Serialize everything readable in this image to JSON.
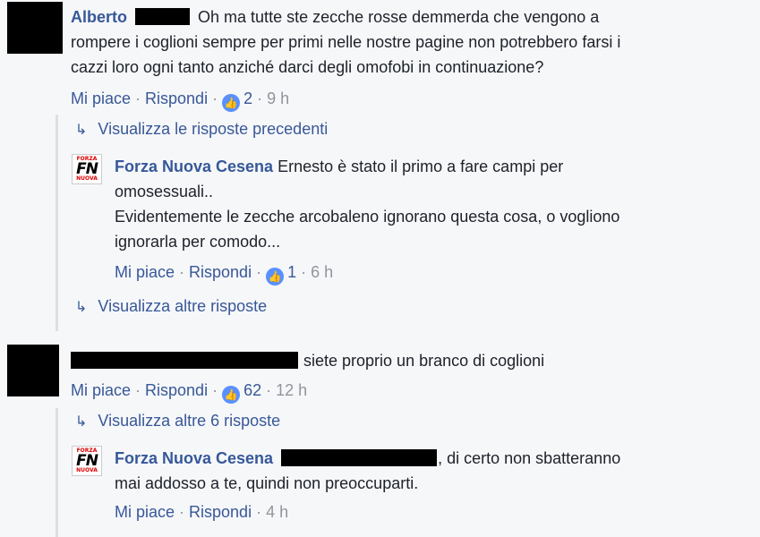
{
  "comments": [
    {
      "author": "Alberto",
      "text_line1": "Oh ma tutte ste zecche rosse demmerda che vengono a",
      "text_line2": "rompere i coglioni sempre per primi nelle nostre pagine non potrebbero farsi i",
      "text_line3": "cazzi loro ogni tanto anziché darci degli omofobi in continuazione?",
      "like_label": "Mi piace",
      "reply_label": "Rispondi",
      "like_count": "2",
      "time": "9 h"
    },
    {
      "text": "siete proprio un branco di coglioni",
      "like_label": "Mi piace",
      "reply_label": "Rispondi",
      "like_count": "62",
      "time": "12 h"
    }
  ],
  "view_previous_replies": "Visualizza le risposte precedenti",
  "replies": [
    {
      "author": "Forza Nuova Cesena",
      "text_line1": "Ernesto è stato il primo a fare campi per",
      "text_line2": "omosessuali..",
      "text_line3": "Evidentemente le zecche arcobaleno ignorano questa cosa, o vogliono",
      "text_line4": "ignorarla per comodo...",
      "like_label": "Mi piace",
      "reply_label": "Rispondi",
      "like_count": "1",
      "time": "6 h"
    },
    {
      "author": "Forza Nuova Cesena",
      "text_line1": ", di certo non sbatteranno",
      "text_line2": "mai addosso a te, quindi non preoccuparti.",
      "like_label": "Mi piace",
      "reply_label": "Rispondi",
      "time": "4 h"
    }
  ],
  "view_more_replies": "Visualizza altre risposte",
  "view_6_more_replies": "Visualizza altre 6 risposte",
  "logo": {
    "top": "FORZA",
    "mid": "FN",
    "bottom": "NUOVA"
  },
  "icons": {
    "like": "thumbs-up-icon",
    "reply_arrow": "reply-arrow-icon"
  },
  "colors": {
    "link": "#385898",
    "author": "#365899",
    "meta": "#90949c",
    "like_badge": "#5890ff"
  }
}
